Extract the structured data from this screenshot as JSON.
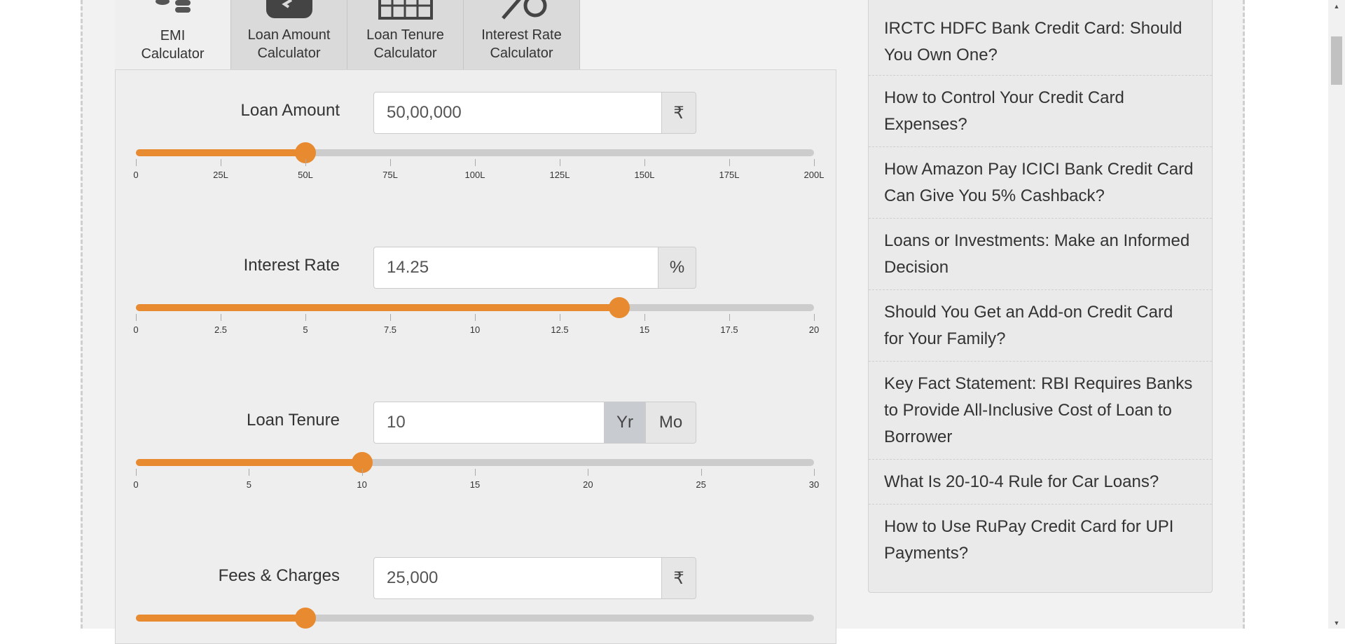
{
  "tabs": [
    {
      "label": "EMI\nCalculator",
      "icon": "coins-icon",
      "active": true
    },
    {
      "label": "Loan Amount Calculator",
      "icon": "calculator-icon",
      "active": false
    },
    {
      "label": "Loan Tenure Calculator",
      "icon": "calendar-icon",
      "active": false
    },
    {
      "label": "Interest Rate Calculator",
      "icon": "percent-icon",
      "active": false
    }
  ],
  "fields": {
    "loan_amount": {
      "label": "Loan Amount",
      "value": "50,00,000",
      "unit": "₹",
      "slider_fraction": 0.25,
      "ticks": [
        "0",
        "25L",
        "50L",
        "75L",
        "100L",
        "125L",
        "150L",
        "175L",
        "200L"
      ]
    },
    "interest_rate": {
      "label": "Interest Rate",
      "value": "14.25",
      "unit": "%",
      "slider_fraction": 0.7125,
      "ticks": [
        "0",
        "2.5",
        "5",
        "7.5",
        "10",
        "12.5",
        "15",
        "17.5",
        "20"
      ]
    },
    "loan_tenure": {
      "label": "Loan Tenure",
      "value": "10",
      "unit_year": "Yr",
      "unit_month": "Mo",
      "selected_unit": "Yr",
      "slider_fraction": 0.3333,
      "ticks": [
        "0",
        "5",
        "10",
        "15",
        "20",
        "25",
        "30"
      ]
    },
    "fees_charges": {
      "label": "Fees & Charges",
      "value": "25,000",
      "unit": "₹",
      "slider_fraction": 0.25
    }
  },
  "sidebar": {
    "articles": [
      "IRCTC HDFC Bank Credit Card: Should You Own One?",
      "How to Control Your Credit Card Expenses?",
      "How Amazon Pay ICICI Bank Credit Card Can Give You 5% Cashback?",
      "Loans or Investments: Make an Informed Decision",
      "Should You Get an Add-on Credit Card for Your Family?",
      "Key Fact Statement: RBI Requires Banks to Provide All-Inclusive Cost of Loan to Borrower",
      "What Is 20-10-4 Rule for Car Loans?",
      "How to Use RuPay Credit Card for UPI Payments?"
    ]
  },
  "colors": {
    "accent": "#e88a2f",
    "track": "#cccccc",
    "panel": "#eeeeee"
  }
}
